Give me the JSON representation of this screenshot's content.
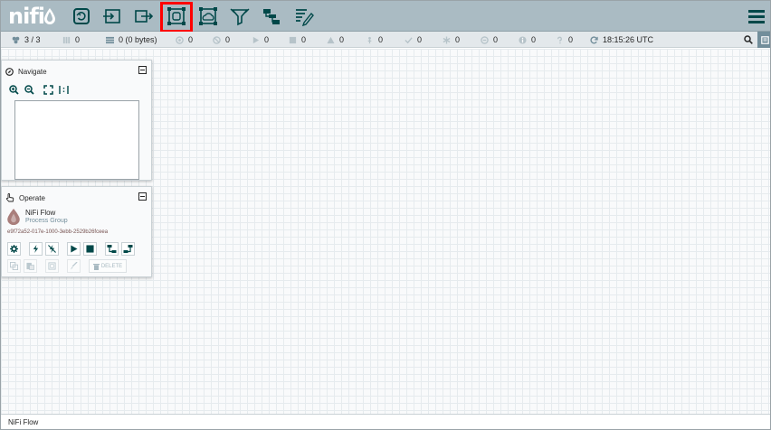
{
  "app": {
    "logo_text": "nifi"
  },
  "toolbar": {
    "items": [
      {
        "name": "processor-button",
        "icon": "processor-icon"
      },
      {
        "name": "input-port-button",
        "icon": "input-port-icon"
      },
      {
        "name": "output-port-button",
        "icon": "output-port-icon"
      },
      {
        "name": "process-group-button",
        "icon": "process-group-icon"
      },
      {
        "name": "remote-process-group-button",
        "icon": "remote-process-group-icon"
      },
      {
        "name": "funnel-button",
        "icon": "funnel-icon"
      },
      {
        "name": "template-button",
        "icon": "template-icon"
      },
      {
        "name": "label-button",
        "icon": "label-icon"
      }
    ],
    "menu_icon": "hamburger-menu-icon",
    "highlight_color": "#ff0000"
  },
  "status": {
    "cluster": "3 / 3",
    "threads": "0",
    "queued": "0 (0 bytes)",
    "transmitting": "0",
    "not_transmitting": "0",
    "running": "0",
    "stopped": "0",
    "invalid": "0",
    "disabled": "0",
    "up_to_date": "0",
    "locally_modified": "0",
    "stale": "0",
    "locally_modified_stale": "0",
    "sync_failure": "0",
    "last_refresh": "18:15:26 UTC"
  },
  "navigate": {
    "title": "Navigate"
  },
  "operate": {
    "title": "Operate",
    "component_name": "NiFi Flow",
    "component_type": "Process Group",
    "component_id": "e9f72a52-017e-1000-3ebb-2529b26fceea",
    "delete_label": "DELETE"
  },
  "footer": {
    "breadcrumb": "NiFi Flow"
  },
  "colors": {
    "header": "#aabbc3",
    "accent": "#004849",
    "statusbar": "#e3e8eb"
  }
}
